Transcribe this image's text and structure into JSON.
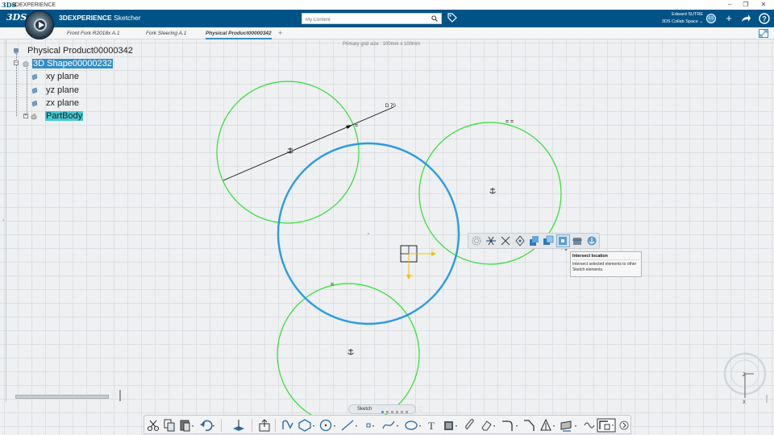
{
  "os_window": {
    "title": "3DEXPERIENCE",
    "controls": [
      "–",
      "❐",
      "✕"
    ]
  },
  "top_bar": {
    "brand_logo": "3DS",
    "app_brand": "3DEXPERIENCE",
    "app_name": "Sketcher",
    "search": {
      "placeholder": "My Content",
      "value": ""
    },
    "user": {
      "name": "Edward SUTRE",
      "space": "3DS Collab Space",
      "initials": "ES"
    },
    "icons": [
      "search-icon",
      "tag-icon",
      "add-icon",
      "share-icon",
      "help-icon"
    ]
  },
  "tabs": [
    {
      "label": "Front Fork R2018x A.1",
      "active": false
    },
    {
      "label": "Fork Steering A.1",
      "active": false
    },
    {
      "label": "Physical Product00000342",
      "active": true
    }
  ],
  "canvas": {
    "grid_info": "Primary grid size : 100mm x 100mm"
  },
  "tree": {
    "root": "Physical Product00000342",
    "shape": "3D Shape00000232",
    "planes": [
      "xy plane",
      "yz plane",
      "zx plane"
    ],
    "body": "PartBody"
  },
  "sketch": {
    "dimension": "D 70",
    "constraint_equal": "=",
    "constraint_equal_double": "= ="
  },
  "context_toolbar": {
    "buttons": [
      "offset-icon",
      "trim-icon",
      "corner-icon",
      "project-icon",
      "project-3d-icon",
      "intersect-3d-icon",
      "intersect-location-icon",
      "cut-part-icon",
      "anchor-icon"
    ]
  },
  "tooltip": {
    "title": "Intersect location",
    "body": "Intersect selected elements to other Sketch elements."
  },
  "compass": {
    "z_label": "Z",
    "x_label": "X"
  },
  "sketch_status": {
    "label": "Sketch",
    "dots_total": 6,
    "dots_active": 1
  },
  "action_bar": {
    "buttons": [
      "cut-icon",
      "copy-icon",
      "paste-icon",
      "undo-icon",
      "sketch-plane-icon",
      "export-icon",
      "profile-icon",
      "polygon-icon",
      "circle-icon",
      "line-icon",
      "point-icon",
      "spline-icon",
      "conic-icon",
      "text-icon",
      "constraint-icon",
      "clip-icon",
      "erase-icon",
      "corner-icon",
      "fillet-icon",
      "mirror-icon",
      "project-icon",
      "transform-icon",
      "view-icon",
      "next-icon"
    ]
  },
  "colors": {
    "brand_blue": "#005386",
    "accent_blue": "#368ec4",
    "green_circle": "#2ee02e",
    "blue_circle": "#2b9be0"
  }
}
